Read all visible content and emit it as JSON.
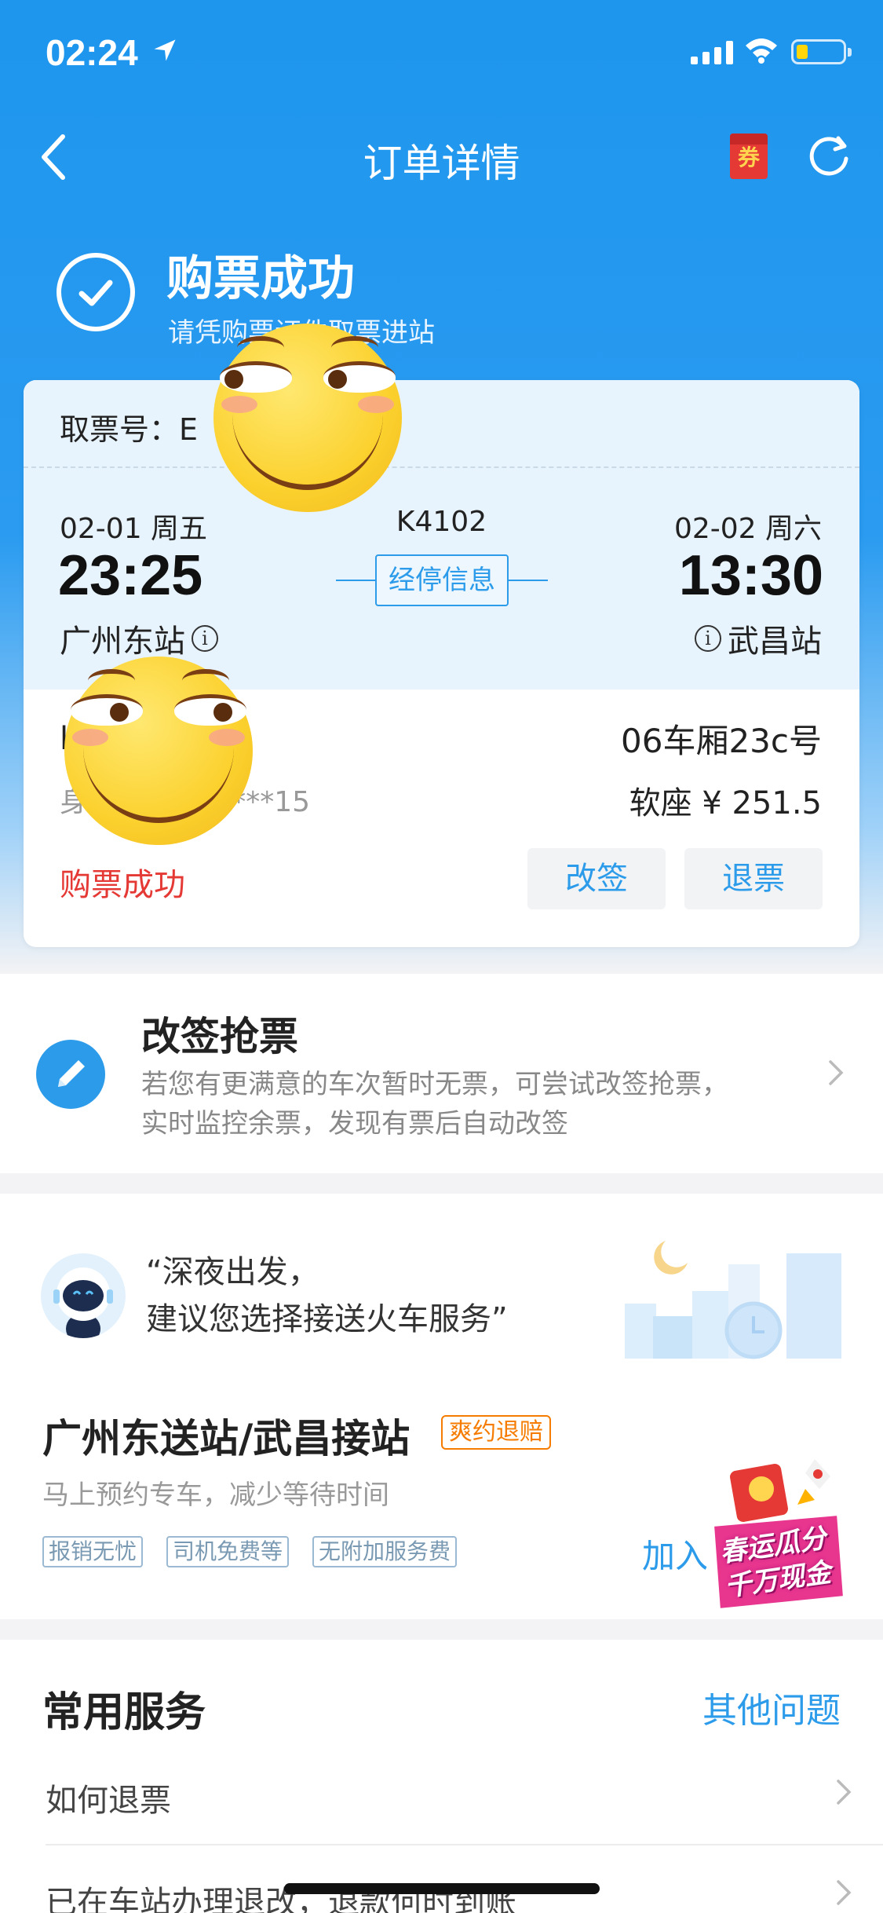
{
  "status_bar": {
    "time": "02:24"
  },
  "nav": {
    "title": "订单详情",
    "coupon_label": "券"
  },
  "success": {
    "title": "购票成功",
    "subtitle": "请凭购票证件取票进站"
  },
  "ticket": {
    "pickup_label": "取票号：E",
    "departure": {
      "date": "02-01  周五",
      "time": "23:25",
      "station": "广州东站"
    },
    "arrival": {
      "date": "02-02  周六",
      "time": "13:30",
      "station": "武昌站"
    },
    "train_no": "K4102",
    "stops_label": "经停信息",
    "passenger_name": "l",
    "passenger_id": "身          31**********15",
    "seat": "06车厢23c号",
    "seat_price": "软座 ¥ 251.5",
    "status": "购票成功",
    "change_label": "改签",
    "refund_label": "退票"
  },
  "grab": {
    "title": "改签抢票",
    "desc_line1": "若您有更满意的车次暂时无票，可尝试改签抢票，",
    "desc_line2": "实时监控余票，发现有票后自动改签"
  },
  "transfer": {
    "quote_line1": "“深夜出发，",
    "quote_line2": "建议您选择接送火车服务”",
    "title": "广州东送站/武昌接站",
    "badge": "爽约退赔",
    "subtitle": "马上预约专车，减少等待时间",
    "tags": [
      "报销无忧",
      "司机免费等",
      "无附加服务费"
    ],
    "join_label": "加入",
    "promo_line1": "春运瓜分",
    "promo_line2": "千万现金"
  },
  "services": {
    "title": "常用服务",
    "other_label": "其他问题",
    "items": [
      "如何退票",
      "已在车站办理退改，退款何时到账"
    ]
  },
  "colors": {
    "primary": "#1e96ee",
    "accent_link": "#2b9bea",
    "status_red": "#e53935",
    "badge_orange": "#f57c00"
  }
}
